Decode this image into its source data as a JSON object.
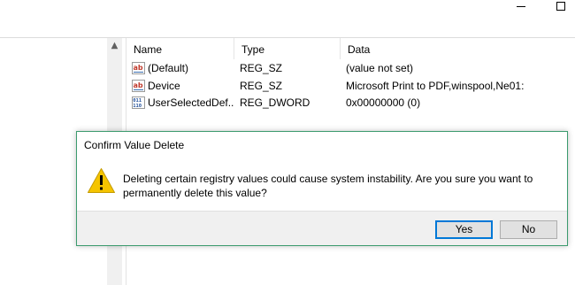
{
  "window": {
    "caption_buttons": [
      "minimize",
      "maximize"
    ]
  },
  "list": {
    "columns": {
      "name": "Name",
      "type": "Type",
      "data": "Data"
    },
    "rows": [
      {
        "icon": "string-value-icon",
        "name": "(Default)",
        "type": "REG_SZ",
        "data": "(value not set)"
      },
      {
        "icon": "string-value-icon",
        "name": "Device",
        "type": "REG_SZ",
        "data": "Microsoft Print to PDF,winspool,Ne01:"
      },
      {
        "icon": "dword-value-icon",
        "name": "UserSelectedDef...",
        "type": "REG_DWORD",
        "data": "0x00000000 (0)"
      }
    ]
  },
  "dialog": {
    "title": "Confirm Value Delete",
    "icon": "warning-icon",
    "message": "Deleting certain registry values could cause system instability. Are you sure you want to permanently delete this value?",
    "buttons": {
      "yes": "Yes",
      "no": "No"
    },
    "accent_color": "#3c9b6e",
    "default_button_color": "#0078d7"
  }
}
